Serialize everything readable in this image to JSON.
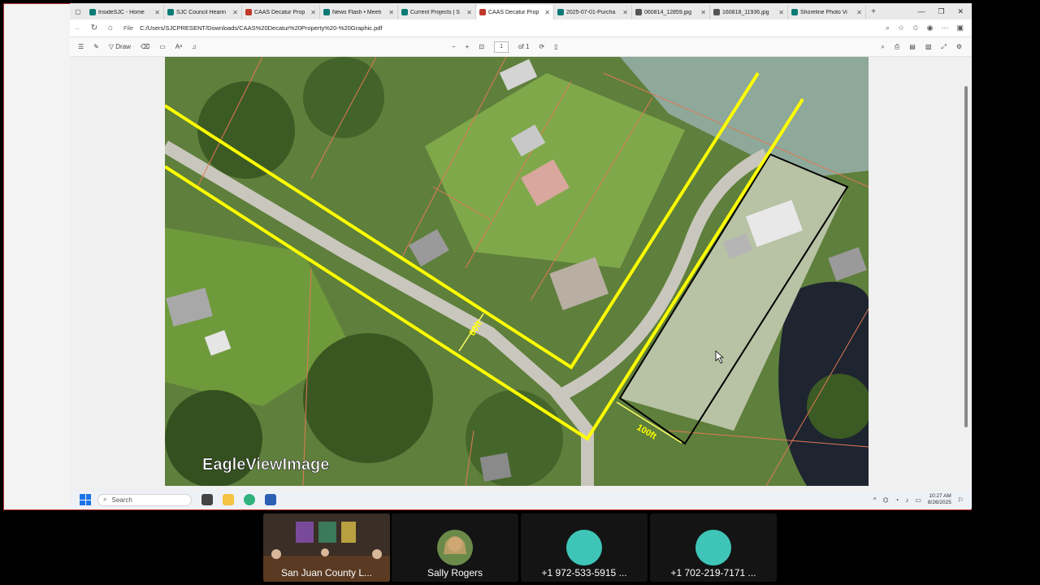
{
  "browser": {
    "tabs": [
      {
        "title": "InsideSJC - Home",
        "color": "#0b7a75",
        "active": false
      },
      {
        "title": "SJC Council Hearin",
        "color": "#0b7a75",
        "active": false
      },
      {
        "title": "CAAS Decatur Prop",
        "color": "#c0392b",
        "active": false
      },
      {
        "title": "News Flash • Meeti",
        "color": "#0b7a75",
        "active": false
      },
      {
        "title": "Current Projects | S",
        "color": "#0b7a75",
        "active": false
      },
      {
        "title": "CAAS Decatur Prop",
        "color": "#c0392b",
        "active": true
      },
      {
        "title": "2025-07-01-Purcha",
        "color": "#0b7a75",
        "active": false
      },
      {
        "title": "060814_12859.jpg",
        "color": "#555555",
        "active": false
      },
      {
        "title": "160818_11936.jpg",
        "color": "#555555",
        "active": false
      },
      {
        "title": "Shoreline Photo Vi",
        "color": "#0b7a75",
        "active": false
      }
    ],
    "address": {
      "scheme_label": "File",
      "url": "C:/Users/SJCPRESENT/Downloads/CAAS%20Decatur%20Property%20-%20Graphic.pdf"
    }
  },
  "pdf_toolbar": {
    "draw_label": "Draw",
    "page_current": "1",
    "page_total": "of 1"
  },
  "map": {
    "watermark": "EagleViewImage",
    "label_60": "60ft",
    "label_100": "100ft",
    "colors": {
      "buffer": "#ffff00",
      "parcel": "#e07a55",
      "property": "#000000"
    }
  },
  "taskbar": {
    "search_placeholder": "Search",
    "time": "10:27 AM",
    "date": "8/26/2025"
  },
  "participants": [
    {
      "name": "San Juan County L..."
    },
    {
      "name": "Sally Rogers"
    },
    {
      "name": "+1 972-533-5915 ..."
    },
    {
      "name": "+1 702-219-7171 ..."
    }
  ]
}
